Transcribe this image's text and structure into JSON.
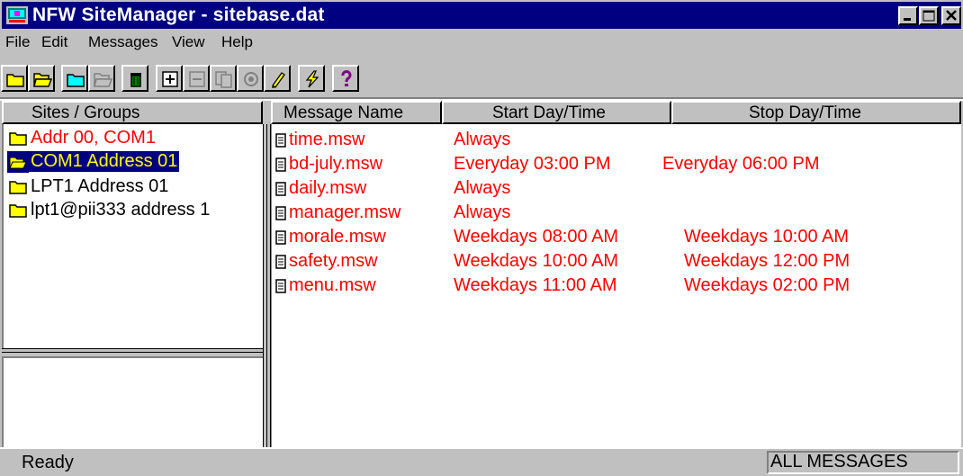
{
  "window": {
    "title": "NFW SiteManager - sitebase.dat"
  },
  "menu": {
    "items": [
      {
        "label": "File"
      },
      {
        "label": "Edit"
      },
      {
        "label": "Messages"
      },
      {
        "label": "View"
      },
      {
        "label": "Help"
      }
    ]
  },
  "toolbar": {
    "buttons": [
      {
        "icon": "folder-icon"
      },
      {
        "icon": "open-folder-icon"
      },
      {
        "icon": "folder-icon"
      },
      {
        "icon": "open-folder-icon"
      },
      {
        "icon": "trash-icon"
      },
      {
        "icon": "add-message-icon"
      },
      {
        "icon": "remove-message-icon"
      },
      {
        "icon": "copy-icon"
      },
      {
        "icon": "properties-icon"
      },
      {
        "icon": "edit-pencil-icon"
      },
      {
        "icon": "lightning-send-icon"
      },
      {
        "icon": "help-question-icon"
      }
    ]
  },
  "sites_header": "Sites / Groups",
  "sites": [
    {
      "label": "Addr 00, COM1",
      "color": "#ff0000",
      "selected": false
    },
    {
      "label": "COM1 Address 01",
      "color": "#ffff00",
      "selected": true
    },
    {
      "label": "LPT1 Address 01",
      "color": "#000000",
      "selected": false
    },
    {
      "label": "lpt1@pii333 address 1",
      "color": "#000000",
      "selected": false
    }
  ],
  "messages": {
    "columns": {
      "name": "Message Name",
      "start": "Start Day/Time",
      "stop": "Stop Day/Time"
    },
    "rows": [
      {
        "name": "time.msw",
        "start": "Always",
        "stop": ""
      },
      {
        "name": "bd-july.msw",
        "start": "Everyday 03:00 PM",
        "stop": "Everyday 06:00 PM"
      },
      {
        "name": "daily.msw",
        "start": "Always",
        "stop": ""
      },
      {
        "name": "manager.msw",
        "start": "Always",
        "stop": ""
      },
      {
        "name": "morale.msw",
        "start": "Weekdays 08:00 AM",
        "stop": "Weekdays 10:00 AM"
      },
      {
        "name": "safety.msw",
        "start": "Weekdays 10:00 AM",
        "stop": "Weekdays 12:00 PM"
      },
      {
        "name": "menu.msw",
        "start": "Weekdays 11:00 AM",
        "stop": "Weekdays 02:00 PM"
      }
    ],
    "text_color": "#ff0000"
  },
  "status": {
    "left": "Ready",
    "right": "ALL MESSAGES"
  },
  "colors": {
    "titlebar": "#000080",
    "face": "#c0c0c0",
    "selection": "#000080",
    "selection_text": "#ffff00"
  }
}
